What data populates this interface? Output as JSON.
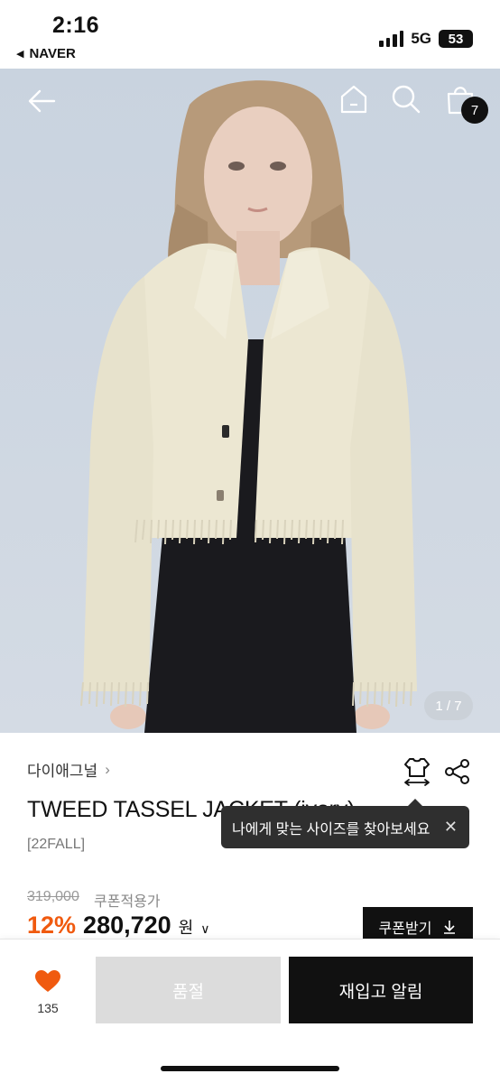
{
  "status_bar": {
    "time": "2:16",
    "back_app": "NAVER",
    "network": "5G",
    "battery": "53"
  },
  "header": {
    "icons": [
      "back-arrow-icon",
      "home-icon",
      "search-icon",
      "shopping-bag-icon"
    ],
    "cart_count": "7"
  },
  "gallery": {
    "counter": "1 / 7",
    "image": "model wearing cream tweed tassel jacket over black dress"
  },
  "product": {
    "brand": "다이애그널",
    "name": "TWEED TASSEL JACKET (ivory)",
    "season": "[22FALL]",
    "size_tooltip": "나에게 맞는 사이즈를 찾아보세요",
    "original_price": "319,000",
    "coupon_note": "쿠폰적용가",
    "discount": "12%",
    "price": "280,720",
    "currency": "원",
    "coupon_button": "쿠폰받기"
  },
  "bottom_bar": {
    "like_count": "135",
    "soldout_label": "품절",
    "restock_label": "재입고 알림"
  },
  "colors": {
    "accent_discount": "#f05a0f",
    "dark": "#111111",
    "soldout_bg": "#dcdcdc"
  }
}
